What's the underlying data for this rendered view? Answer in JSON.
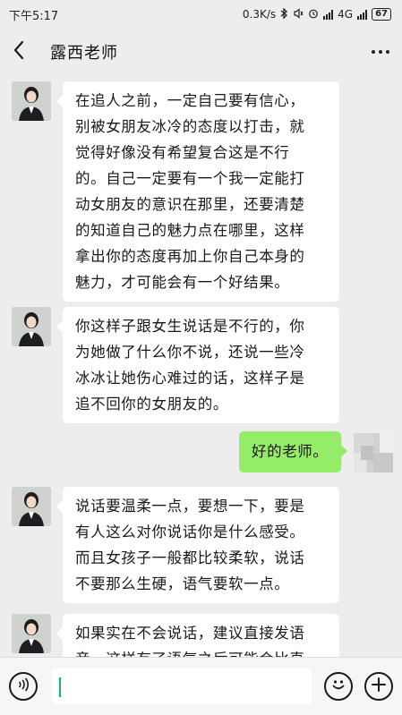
{
  "status_bar": {
    "time": "下午5:17",
    "speed": "0.3K/s",
    "network": "4G",
    "battery": "67"
  },
  "header": {
    "back_icon": "chevron-left-icon",
    "title": "露西老师",
    "more_icon": "more-dots-icon"
  },
  "messages": [
    {
      "side": "left",
      "sender": "露西老师",
      "lines": [
        "在追人之前，一定自己要有信心，",
        "别被女朋友冰冷的态度以打击，就",
        "觉得好像没有希望复合这是不行",
        "的。自己一定要有一个我一定能打",
        "动女朋友的意识在那里，还要清楚",
        "的知道自己的魅力点在哪里，这样",
        "拿出你的态度再加上你自己本身的",
        "魅力，才可能会有一个好结果。"
      ]
    },
    {
      "side": "left",
      "sender": "露西老师",
      "lines": [
        "你这样子跟女生说话是不行的，你",
        "为她做了什么你不说，还说一些冷",
        "冰冰让她伤心难过的话，这样子是",
        "追不回你的女朋友的。"
      ]
    },
    {
      "side": "right",
      "sender": "me",
      "lines": [
        "好的老师。"
      ]
    },
    {
      "side": "left",
      "sender": "露西老师",
      "lines": [
        "说话要温柔一点，要想一下，要是",
        "有人这么对你说话你是什么感受。",
        "而且女孩子一般都比较柔软，说话",
        "不要那么生硬，语气要软一点。"
      ]
    },
    {
      "side": "left",
      "sender": "露西老师",
      "lines": [
        "如果实在不会说话，建议直接发语",
        "音，这样有了语气之后可能会比直"
      ]
    }
  ],
  "input_bar": {
    "voice_icon": "voice-icon",
    "text_value": "",
    "emoji_icon": "emoji-icon",
    "plus_icon": "plus-icon"
  },
  "colors": {
    "background": "#ededed",
    "bubble_received": "#ffffff",
    "bubble_sent": "#95ec69",
    "caret": "#07c160"
  }
}
